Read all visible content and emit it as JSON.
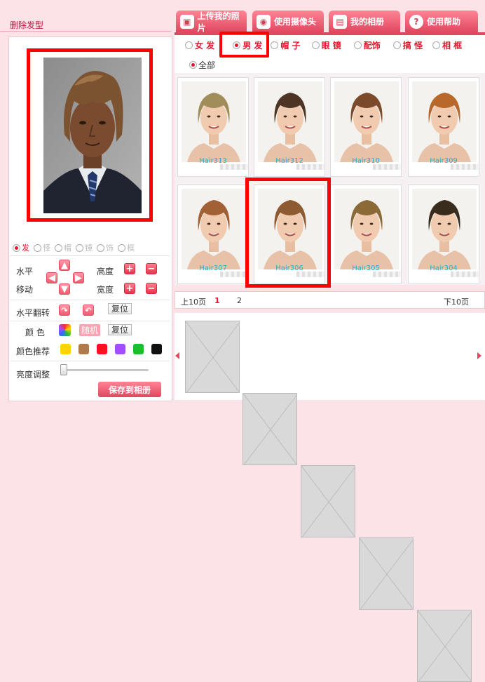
{
  "left": {
    "title": "删除发型",
    "categories": [
      {
        "label": "发",
        "selected": true
      },
      {
        "label": "怪",
        "selected": false
      },
      {
        "label": "帽",
        "selected": false
      },
      {
        "label": "镜",
        "selected": false
      },
      {
        "label": "饰",
        "selected": false
      },
      {
        "label": "框",
        "selected": false
      }
    ],
    "horizontal_label": "水平",
    "move_label": "移动",
    "height_label": "高度",
    "width_label": "宽度",
    "flip_label": "水平翻转",
    "reset_label": "复位",
    "color_label": "颜 色",
    "random_label": "随机",
    "color_reset_label": "复位",
    "recommend_label": "颜色推荐",
    "brightness_label": "亮度调整",
    "brightness_value": 0,
    "save_label": "保存到相册"
  },
  "colors": {
    "swatches": [
      "#ffd400",
      "#b07a4a",
      "#ff1020",
      "#a24dff",
      "#1bbf2e",
      "#111111"
    ],
    "accent": "#e4162f",
    "highlight_box": "#ff0000"
  },
  "tabs": [
    {
      "label": "上传我的照片",
      "icon": "upload-photo-icon"
    },
    {
      "label": "使用摄像头",
      "icon": "webcam-icon"
    },
    {
      "label": "我的相册",
      "icon": "album-icon"
    },
    {
      "label": "使用帮助",
      "icon": "help-icon"
    }
  ],
  "filters": {
    "items": [
      {
        "label": "女 发",
        "selected": false
      },
      {
        "label": "男 发",
        "selected": true
      },
      {
        "label": "帽 子",
        "selected": false
      },
      {
        "label": "眼 镜",
        "selected": false
      },
      {
        "label": "配饰",
        "selected": false
      },
      {
        "label": "搞 怪",
        "selected": false
      },
      {
        "label": "相 框",
        "selected": false
      }
    ],
    "all_label": "全部"
  },
  "hairstyles": [
    {
      "num": "1",
      "name": "Hair313",
      "color": "#a18d5a"
    },
    {
      "num": "2",
      "name": "Hair312",
      "color": "#4e3424"
    },
    {
      "num": "3",
      "name": "Hair310",
      "color": "#7a4a2a"
    },
    {
      "num": "4",
      "name": "Hair309",
      "color": "#b8682a"
    },
    {
      "num": "5",
      "name": "Hair307",
      "color": "#a26035"
    },
    {
      "num": "6",
      "name": "Hair306",
      "color": "#8e5a32"
    },
    {
      "num": "7",
      "name": "Hair305",
      "color": "#8b6a38"
    },
    {
      "num": "8",
      "name": "Hair304",
      "color": "#3a2c1c"
    }
  ],
  "pager": {
    "prev_label": "上10页",
    "pages": [
      "1",
      "2"
    ],
    "current": "1",
    "next_label": "下10页"
  },
  "album": {
    "slots": 5
  }
}
